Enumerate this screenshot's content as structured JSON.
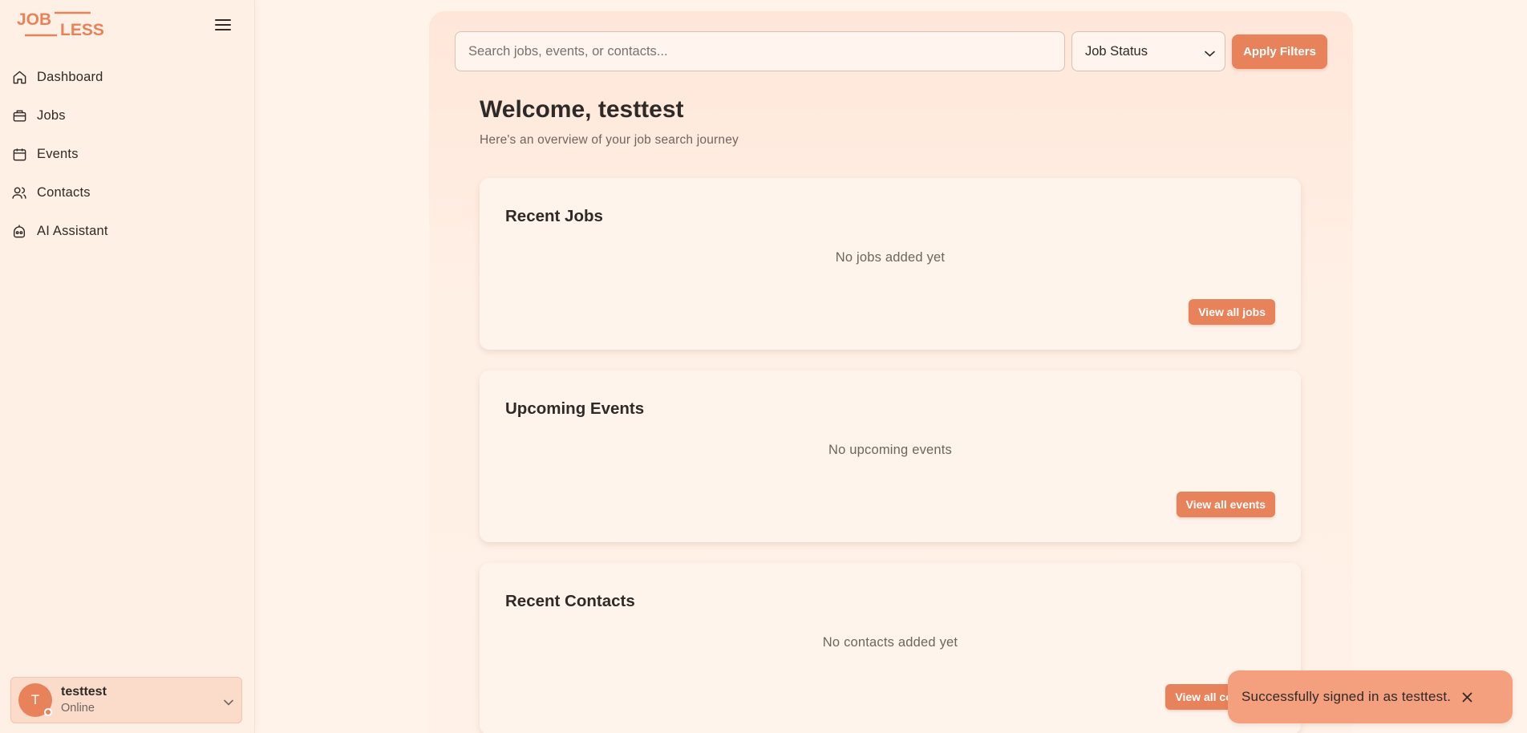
{
  "app": {
    "logo_top": "JOB",
    "logo_bottom": "LESS"
  },
  "sidebar": {
    "items": [
      {
        "label": "Dashboard",
        "icon": "home-icon"
      },
      {
        "label": "Jobs",
        "icon": "briefcase-icon"
      },
      {
        "label": "Events",
        "icon": "calendar-icon"
      },
      {
        "label": "Contacts",
        "icon": "users-icon"
      },
      {
        "label": "AI Assistant",
        "icon": "robot-icon"
      }
    ]
  },
  "user": {
    "initial": "T",
    "name": "testtest",
    "status": "Online"
  },
  "filters": {
    "search_placeholder": "Search jobs, events, or contacts...",
    "status_selected": "Job Status",
    "apply_label": "Apply Filters"
  },
  "main": {
    "welcome": "Welcome, testtest",
    "subtitle": "Here's an overview of your job search journey"
  },
  "cards": {
    "jobs": {
      "title": "Recent Jobs",
      "empty": "No jobs added yet",
      "button": "View all jobs"
    },
    "events": {
      "title": "Upcoming Events",
      "empty": "No upcoming events",
      "button": "View all events"
    },
    "contacts": {
      "title": "Recent Contacts",
      "empty": "No contacts added yet",
      "button": "View all contacts"
    }
  },
  "toast": {
    "message": "Successfully signed in as testtest."
  },
  "colors": {
    "accent": "#e8825a",
    "background": "#fff3ea",
    "toast": "#f4a07f"
  }
}
